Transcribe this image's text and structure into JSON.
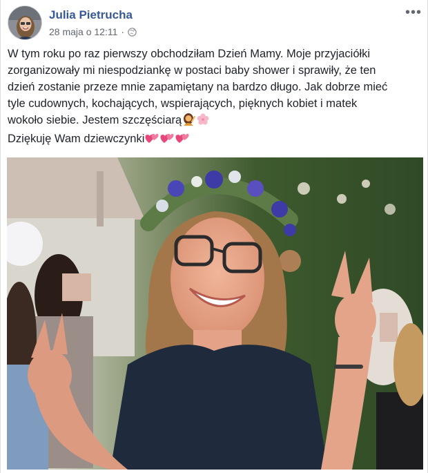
{
  "post": {
    "author": "Julia Pietrucha",
    "timestamp": "28 maja o 12:11",
    "privacy_icon": "globe-icon",
    "more_icon": "more-options-icon",
    "more_label": "•••",
    "text_lines": [
      "W tym roku po raz pierwszy obchodziłam Dzień Mamy. Moje przyjaciółki",
      "zorganizowały mi niespodziankę w postaci baby shower i sprawiły, że ten",
      "dzień zostanie przeze mnie zapamiętany na bardzo długo. Jak dobrze mieć",
      "tyle cudownych, kochających, wspierających, pięknych kobiet i matek",
      "wokoło siebie. Jestem szczęściarą",
      "Dziękuję Wam dziewczynki"
    ],
    "emojis": {
      "line5": [
        "woman-gesturing-emoji",
        "cherry-blossom-emoji"
      ],
      "line6": [
        "sparkling-heart-emoji",
        "sparkling-heart-emoji",
        "sparkling-heart-emoji"
      ]
    }
  },
  "colors": {
    "author_link": "#365899",
    "meta_text": "#616770",
    "body_text": "#1d2129"
  }
}
